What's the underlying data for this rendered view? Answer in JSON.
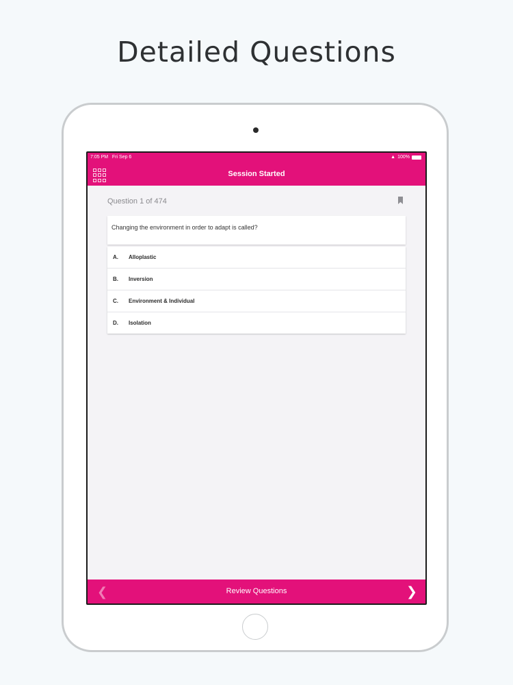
{
  "headline": "Detailed Questions",
  "status": {
    "time": "7:05 PM",
    "date": "Fri Sep 6",
    "battery": "100%",
    "wifi_icon": "wifi-icon",
    "battery_icon": "battery-icon"
  },
  "navbar": {
    "title": "Session Started",
    "menu_icon": "grid-icon"
  },
  "question": {
    "counter": "Question 1 of 474",
    "bookmark_icon": "bookmark-icon",
    "text": "Changing the environment in order to adapt is called?"
  },
  "answers": [
    {
      "letter": "A.",
      "text": "Alloplastic"
    },
    {
      "letter": "B.",
      "text": "Inversion"
    },
    {
      "letter": "C.",
      "text": "Environment & Individual"
    },
    {
      "letter": "D.",
      "text": "Isolation"
    }
  ],
  "bottombar": {
    "label": "Review Questions",
    "prev_icon": "chevron-left-icon",
    "next_icon": "chevron-right-icon"
  },
  "colors": {
    "accent": "#e3117a",
    "background": "#f5f9fb",
    "content_bg": "#f4f3f6"
  }
}
